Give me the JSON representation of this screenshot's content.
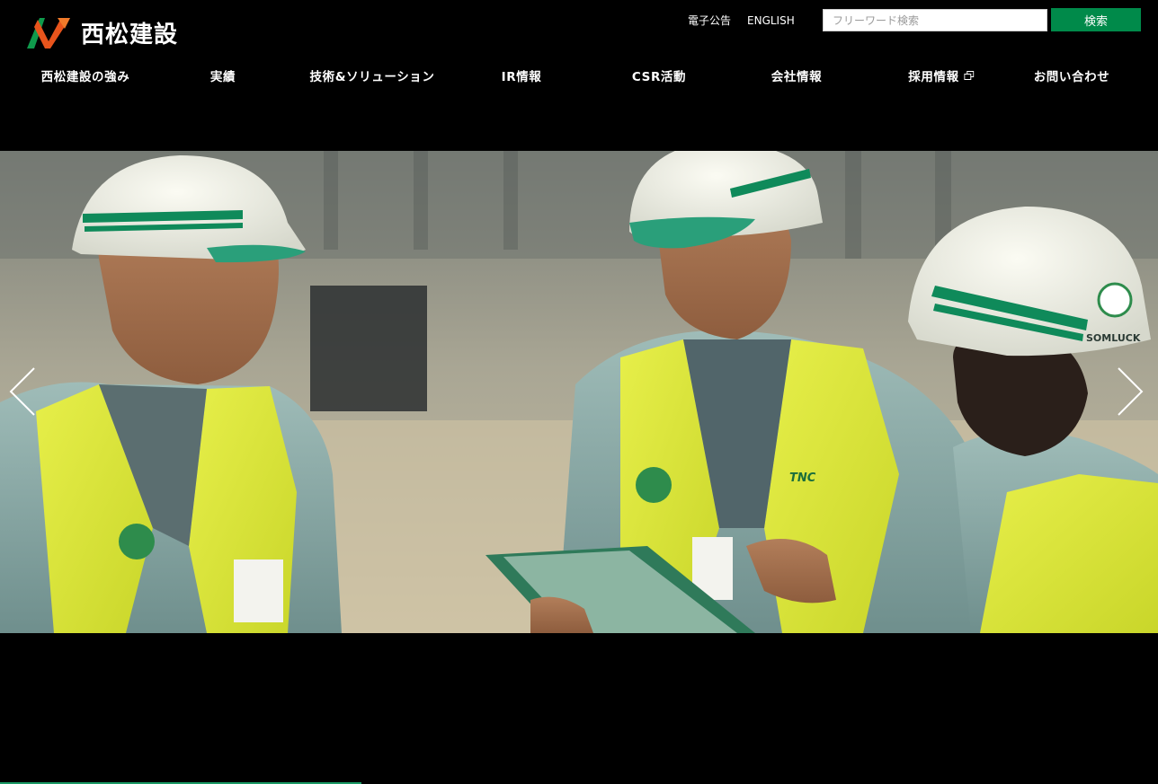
{
  "header": {
    "logo_text": "西松建設",
    "utility_links": [
      {
        "label": "電子公告"
      },
      {
        "label": "ENGLISH"
      }
    ],
    "search": {
      "placeholder": "フリーワード検索",
      "button_label": "検索"
    }
  },
  "nav": {
    "items": [
      {
        "label": "西松建設の強み"
      },
      {
        "label": "実績"
      },
      {
        "label": "技術&ソリューション"
      },
      {
        "label": "IR情報"
      },
      {
        "label": "CSR活動"
      },
      {
        "label": "会社情報"
      },
      {
        "label": "採用情報",
        "external": true
      },
      {
        "label": "お問い合わせ"
      }
    ]
  },
  "hero": {
    "helmet_label": "SOMLUCK",
    "vest_logo": "TNC"
  },
  "colors": {
    "brand_green": "#008a4a",
    "brand_orange": "#e8541c",
    "progress": "#1a9a66",
    "background": "#000000"
  },
  "icons": {
    "external_link": "external-window-icon",
    "prev": "chevron-left-icon",
    "next": "chevron-right-icon"
  }
}
